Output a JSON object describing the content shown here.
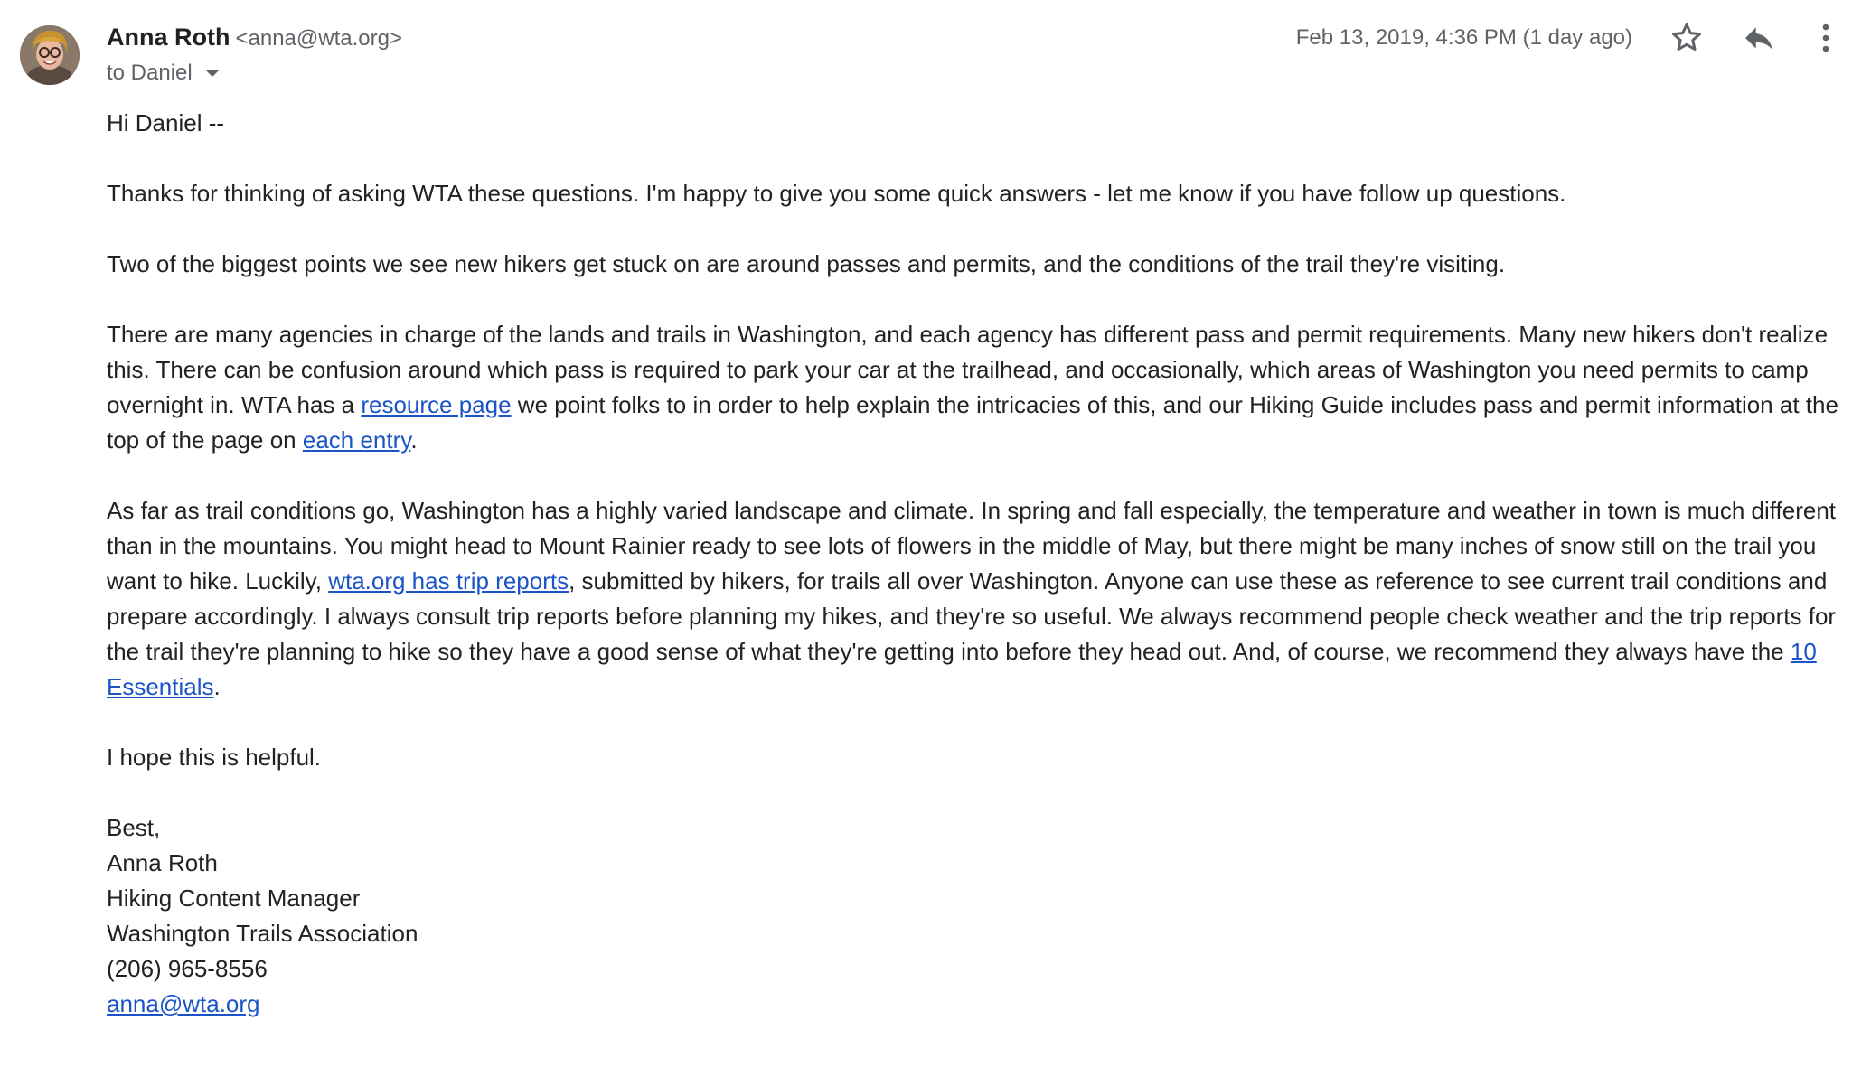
{
  "sender": {
    "name": "Anna Roth",
    "email": "<anna@wta.org>",
    "to_label": "to Daniel"
  },
  "header": {
    "timestamp": "Feb 13, 2019, 4:36 PM (1 day ago)",
    "star_icon": "star-outline-icon",
    "reply_icon": "reply-icon",
    "more_icon": "more-vert-icon"
  },
  "body": {
    "greeting": "Hi Daniel --",
    "p1": "Thanks for thinking of asking WTA these questions. I'm happy to give you some quick answers - let me know if you have follow up questions.",
    "p2": "Two of the biggest points we see new hikers get stuck on are around passes and permits, and the conditions of the trail they're visiting.",
    "p3_a": "There are many agencies in charge of the lands and trails in Washington, and each agency has different pass and permit requirements. Many new hikers don't realize this. There can be confusion around which pass is required to park your car at the trailhead, and occasionally, which areas of Washington you need permits to camp overnight in. WTA has a ",
    "p3_link1": "resource page",
    "p3_b": " we point folks to in order to help explain the intricacies of this, and our Hiking Guide includes pass and permit information at the top of the page on ",
    "p3_link2": "each entry",
    "p3_c": ".",
    "p4_a": "As far as trail conditions go, Washington has a highly varied landscape and climate. In spring and fall especially, the temperature and weather in town is much different than in the mountains. You might head to Mount Rainier ready to see lots of flowers in the middle of May, but there might be many inches of snow still on the trail you want to hike. Luckily, ",
    "p4_link1": "wta.org has trip reports",
    "p4_b": ", submitted by hikers, for trails all over Washington. Anyone can use these as reference to see current  trail conditions and prepare accordingly. I always consult trip reports before planning my hikes, and they're so useful. We always recommend people check weather and the trip reports for the trail they're planning to hike so they have a good sense of what they're getting into before they head out. And, of course, we recommend they always have the ",
    "p4_link2": "10 Essentials",
    "p4_c": ".",
    "p5": "I hope this is helpful."
  },
  "signature": {
    "closing": "Best,",
    "name": "Anna Roth",
    "title": "Hiking Content Manager",
    "org": "Washington Trails Association",
    "phone": "(206) 965-8556",
    "email": "anna@wta.org"
  },
  "colors": {
    "link": "#1a54c8",
    "text": "#222222",
    "muted": "#5f6368"
  }
}
